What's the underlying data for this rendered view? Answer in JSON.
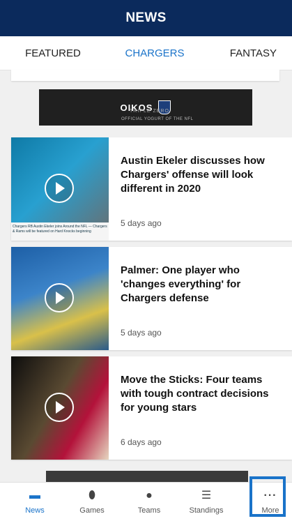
{
  "header": {
    "title": "NEWS"
  },
  "tabs": [
    {
      "label": "FEATURED"
    },
    {
      "label": "CHARGERS",
      "active": true
    },
    {
      "label": "FANTASY"
    }
  ],
  "banner": {
    "brand": "OIKOS",
    "sub1": "TRIPLE ZERO",
    "sub2": "OFFICIAL YOGURT OF THE NFL"
  },
  "articles": [
    {
      "headline": "Austin Ekeler discusses how Chargers' offense will look different in 2020",
      "time": "5 days ago",
      "thumb_caption": "Chargers RB Austin Ekeler joins Around the NFL — Chargers & Rams will be featured on Hard Knocks beginning"
    },
    {
      "headline": "Palmer: One player who 'changes everything' for Chargers defense",
      "time": "5 days ago"
    },
    {
      "headline": "Move the Sticks: Four teams with tough contract decisions for young stars",
      "time": "6 days ago"
    }
  ],
  "tabbar": [
    {
      "label": "News",
      "icon": "news-icon",
      "active": true
    },
    {
      "label": "Games",
      "icon": "football-icon"
    },
    {
      "label": "Teams",
      "icon": "helmet-icon"
    },
    {
      "label": "Standings",
      "icon": "list-icon"
    },
    {
      "label": "More",
      "icon": "more-dots-icon"
    }
  ],
  "colors": {
    "header_bg": "#0b2a5c",
    "accent": "#1a73c9"
  }
}
